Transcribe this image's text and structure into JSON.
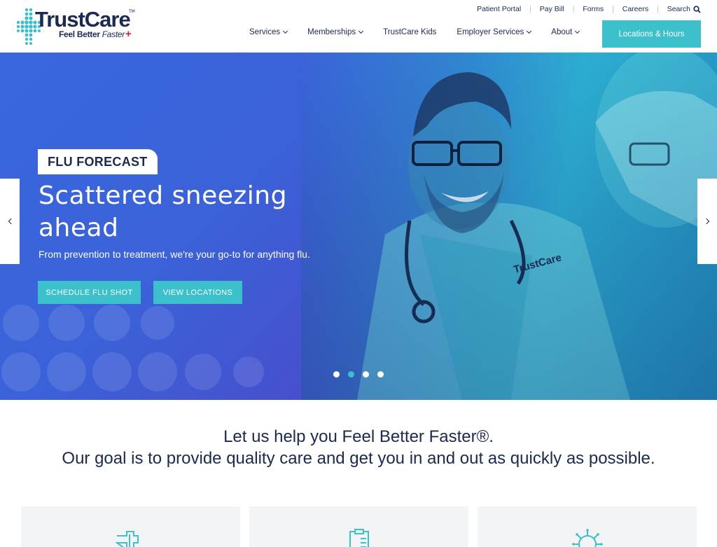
{
  "brand": {
    "name": "TrustCare",
    "tm": "TM",
    "tagline_bold": "Feel Better",
    "tagline_italic": "Faster"
  },
  "util_nav": {
    "items": [
      "Patient Portal",
      "Pay Bill",
      "Forms",
      "Careers"
    ],
    "search_label": "Search"
  },
  "main_nav": {
    "items": [
      {
        "label": "Services",
        "has_dropdown": true
      },
      {
        "label": "Memberships",
        "has_dropdown": true
      },
      {
        "label": "TrustCare Kids",
        "has_dropdown": false
      },
      {
        "label": "Employer Services",
        "has_dropdown": true
      },
      {
        "label": "About",
        "has_dropdown": true
      }
    ],
    "cta_label": "Locations & Hours"
  },
  "hero": {
    "tag": "FLU FORECAST",
    "title_line1": "Scattered sneezing",
    "title_line2": "ahead",
    "subtitle": "From prevention to treatment, we're your go-to for anything flu.",
    "primary_button": "SCHEDULE FLU SHOT",
    "secondary_button": "VIEW LOCATIONS",
    "slide_count": 4,
    "active_slide": 2
  },
  "intro": {
    "line1": "Let us help you Feel Better Faster®.",
    "line2": "Our goal is to provide quality care and get you in and out as quickly as possible."
  },
  "cards": [
    {
      "icon": "medical-cross-icon"
    },
    {
      "icon": "clipboard-icon"
    },
    {
      "icon": "virus-icon"
    }
  ],
  "colors": {
    "navy": "#1b2a52",
    "teal": "#3bc0cc",
    "hero_blue": "#3a66e0",
    "hero_purple": "#5a3cb6",
    "red": "#e0192c",
    "card_bg": "#f3f4f6"
  }
}
